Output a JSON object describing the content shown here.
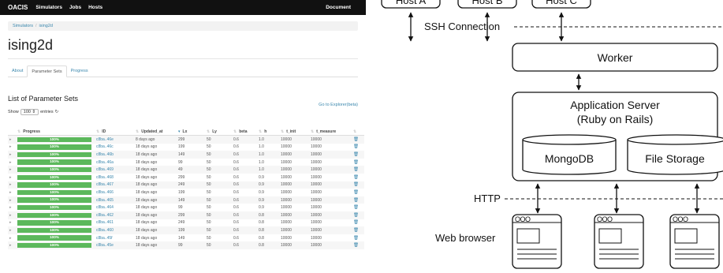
{
  "app": {
    "brand": "OACIS",
    "nav": [
      "Simulators",
      "Jobs",
      "Hosts"
    ],
    "nav_right": "Document",
    "breadcrumb": [
      "Simulators",
      "ising2d"
    ],
    "title": "ising2d",
    "tabs": [
      "About",
      "Parameter Sets",
      "Progress"
    ],
    "section_title": "List of Parameter Sets",
    "show_label": "Show",
    "show_value": "100",
    "entries_label": "entries",
    "explorer_link": "Go to Explorer(beta)",
    "columns": [
      "Progress",
      "ID",
      "Updated_at",
      "Lx",
      "Ly",
      "beta",
      "h",
      "t_init",
      "t_measure"
    ],
    "rows": [
      {
        "progress": "100%",
        "id": "c8ba..46e",
        "updated": "8 days ago",
        "lx": "299",
        "ly": "50",
        "beta": "0.6",
        "h": "1.0",
        "t_init": "10000",
        "t_measure": "10000"
      },
      {
        "progress": "100%",
        "id": "c8ba..46c",
        "updated": "18 days ago",
        "lx": "199",
        "ly": "50",
        "beta": "0.6",
        "h": "1.0",
        "t_init": "10000",
        "t_measure": "10000"
      },
      {
        "progress": "100%",
        "id": "c8ba..46b",
        "updated": "18 days ago",
        "lx": "149",
        "ly": "50",
        "beta": "0.6",
        "h": "1.0",
        "t_init": "10000",
        "t_measure": "10000"
      },
      {
        "progress": "100%",
        "id": "c8ba..46a",
        "updated": "18 days ago",
        "lx": "99",
        "ly": "50",
        "beta": "0.6",
        "h": "1.0",
        "t_init": "10000",
        "t_measure": "10000"
      },
      {
        "progress": "100%",
        "id": "c8ba..469",
        "updated": "18 days ago",
        "lx": "49",
        "ly": "50",
        "beta": "0.6",
        "h": "1.0",
        "t_init": "10000",
        "t_measure": "10000"
      },
      {
        "progress": "100%",
        "id": "c8ba..468",
        "updated": "18 days ago",
        "lx": "299",
        "ly": "50",
        "beta": "0.6",
        "h": "0.9",
        "t_init": "10000",
        "t_measure": "10000"
      },
      {
        "progress": "100%",
        "id": "c8ba..467",
        "updated": "18 days ago",
        "lx": "249",
        "ly": "50",
        "beta": "0.6",
        "h": "0.9",
        "t_init": "10000",
        "t_measure": "10000"
      },
      {
        "progress": "100%",
        "id": "c8ba..466",
        "updated": "18 days ago",
        "lx": "199",
        "ly": "50",
        "beta": "0.6",
        "h": "0.9",
        "t_init": "10000",
        "t_measure": "10000"
      },
      {
        "progress": "100%",
        "id": "c8ba..465",
        "updated": "18 days ago",
        "lx": "149",
        "ly": "50",
        "beta": "0.6",
        "h": "0.9",
        "t_init": "10000",
        "t_measure": "10000"
      },
      {
        "progress": "100%",
        "id": "c8ba..464",
        "updated": "18 days ago",
        "lx": "99",
        "ly": "50",
        "beta": "0.6",
        "h": "0.9",
        "t_init": "10000",
        "t_measure": "10000"
      },
      {
        "progress": "100%",
        "id": "c8ba..462",
        "updated": "18 days ago",
        "lx": "299",
        "ly": "50",
        "beta": "0.6",
        "h": "0.8",
        "t_init": "10000",
        "t_measure": "10000"
      },
      {
        "progress": "100%",
        "id": "c8ba..461",
        "updated": "18 days ago",
        "lx": "249",
        "ly": "50",
        "beta": "0.6",
        "h": "0.8",
        "t_init": "10000",
        "t_measure": "10000"
      },
      {
        "progress": "100%",
        "id": "c8ba..460",
        "updated": "18 days ago",
        "lx": "199",
        "ly": "50",
        "beta": "0.6",
        "h": "0.8",
        "t_init": "10000",
        "t_measure": "10000"
      },
      {
        "progress": "100%",
        "id": "c8ba..45f",
        "updated": "18 days ago",
        "lx": "149",
        "ly": "50",
        "beta": "0.6",
        "h": "0.8",
        "t_init": "10000",
        "t_measure": "10000"
      },
      {
        "progress": "100%",
        "id": "c8ba..45e",
        "updated": "18 days ago",
        "lx": "99",
        "ly": "50",
        "beta": "0.6",
        "h": "0.8",
        "t_init": "10000",
        "t_measure": "10000"
      }
    ],
    "colors": {
      "navbar": "#111111",
      "progress_bar": "#5cb85c",
      "link": "#3a87ad"
    }
  },
  "diagram": {
    "hosts": [
      "Host A",
      "Host B",
      "Host C"
    ],
    "ssh_label": "SSH Connection",
    "worker": "Worker",
    "app_server_line1": "Application Server",
    "app_server_line2": "(Ruby on Rails)",
    "mongodb": "MongoDB",
    "file_storage": "File Storage",
    "http_label": "HTTP",
    "browser_label": "Web browser",
    "browser_dots": "OOO"
  }
}
